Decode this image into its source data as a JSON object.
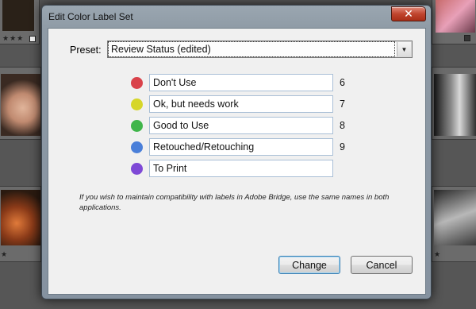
{
  "dialog": {
    "title": "Edit Color Label Set",
    "close_glyph": "✕",
    "preset_label": "Preset:",
    "preset_value": "Review Status (edited)",
    "labels": [
      {
        "color": "#d9424a",
        "name": "Don't Use",
        "shortcut": "6"
      },
      {
        "color": "#d6d629",
        "name": "Ok, but needs work",
        "shortcut": "7"
      },
      {
        "color": "#3fb54a",
        "name": "Good to Use",
        "shortcut": "8"
      },
      {
        "color": "#4a7fd9",
        "name": "Retouched/Retouching",
        "shortcut": "9"
      },
      {
        "color": "#7e49d6",
        "name": "To Print",
        "shortcut": ""
      }
    ],
    "note": "If you wish to maintain compatibility with labels in Adobe Bridge, use the same names in both applications.",
    "change_button": "Change",
    "cancel_button": "Cancel"
  },
  "background": {
    "stars": "★★★",
    "star_single": "★"
  }
}
